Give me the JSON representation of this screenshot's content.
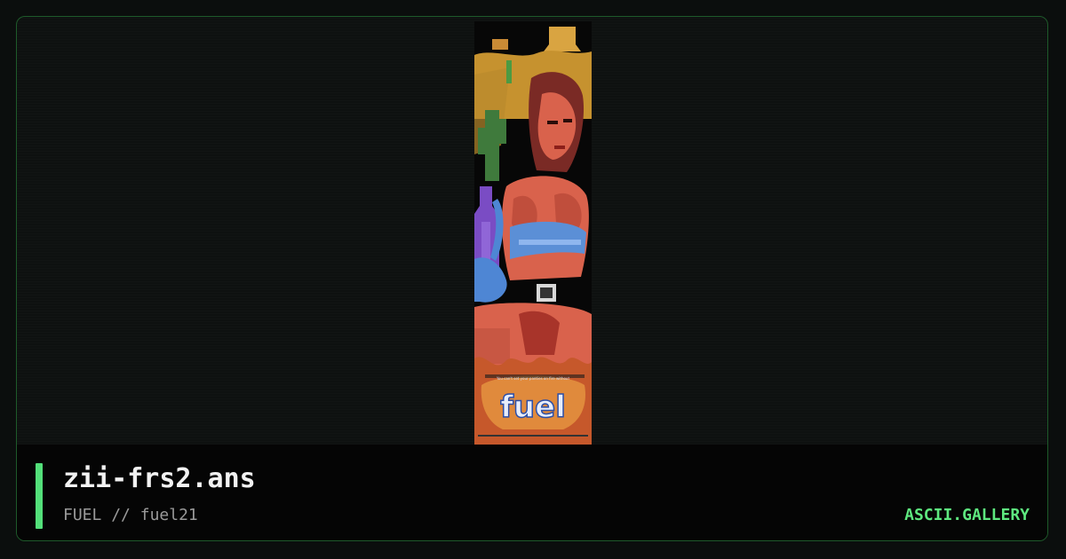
{
  "artwork": {
    "filename": "zii-frs2.ans",
    "group": "FUEL",
    "separator": "//",
    "pack": "fuel21",
    "logo_text": "fuel",
    "tagline": "You can't set your panties on fire without"
  },
  "brand": {
    "label": "ASCII.GALLERY"
  },
  "colors": {
    "accent": "#53e07a",
    "brand": "#5ee87f",
    "frame_border": "#1e5a2a",
    "background": "#0b0e0d"
  },
  "icons": {
    "accent_bar": "vertical-accent-bar"
  }
}
